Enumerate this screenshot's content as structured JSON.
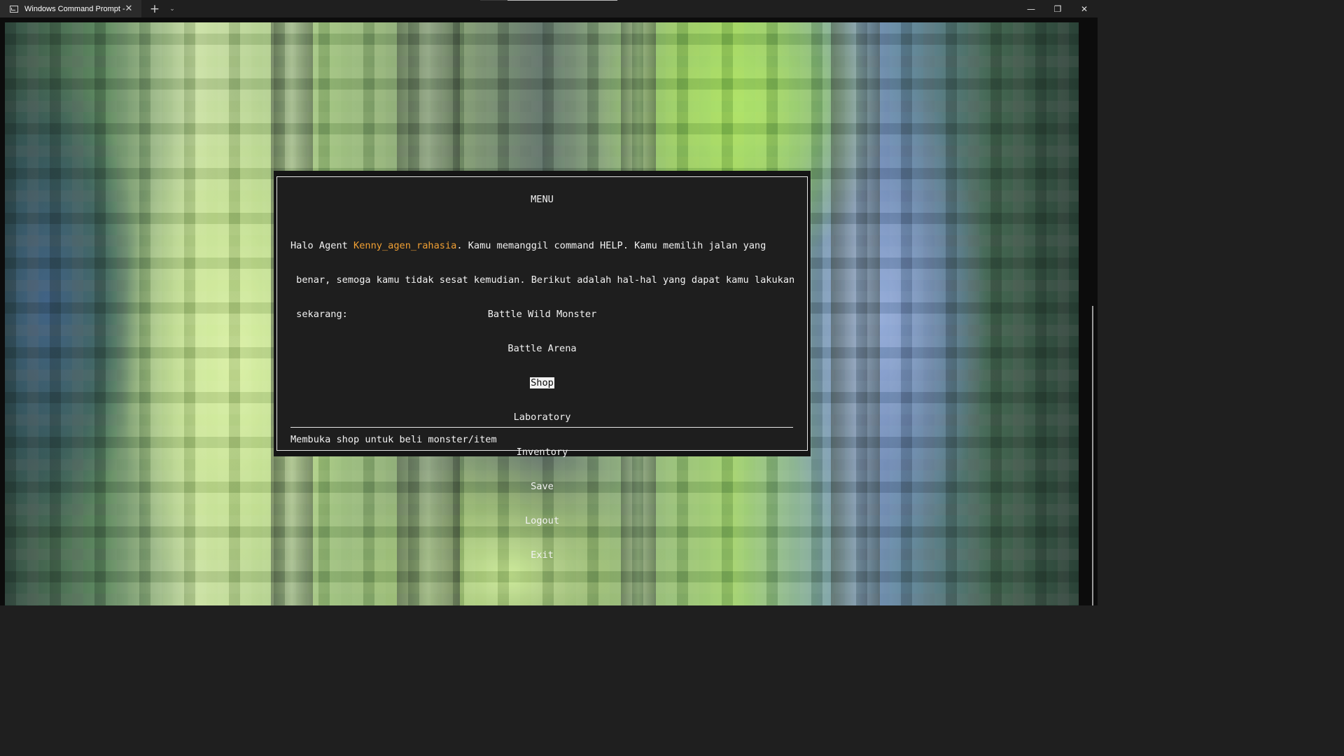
{
  "window": {
    "tab_title": "Windows Command Prompt -",
    "tab_icon": "terminal-icon",
    "tab_close": "✕",
    "new_tab": "+",
    "tab_dropdown": "⌄",
    "minimize": "—",
    "maximize": "❐",
    "close": "✕"
  },
  "menu": {
    "title": "MENU",
    "intro_prefix": "Halo Agent ",
    "agent_name": "Kenny_agen_rahasia",
    "intro_suffix": ". Kamu memanggil command HELP. Kamu memilih jalan yang",
    "intro_line2": " benar, semoga kamu tidak sesat kemudian. Berikut adalah hal-hal yang dapat kamu lakukan",
    "intro_line3": " sekarang:",
    "options": [
      "Battle Wild Monster",
      "Battle Arena",
      "Shop",
      "Laboratory",
      "Inventory",
      "Save",
      "Logout",
      "Exit"
    ],
    "selected_option": "Shop",
    "description": "Membuka shop untuk beli monster/item"
  },
  "colors": {
    "agent_name": "#f2a033",
    "text": "#f2f2f2",
    "panel_bg": "#1e1e1e",
    "titlebar_bg": "#1f1f1f"
  }
}
